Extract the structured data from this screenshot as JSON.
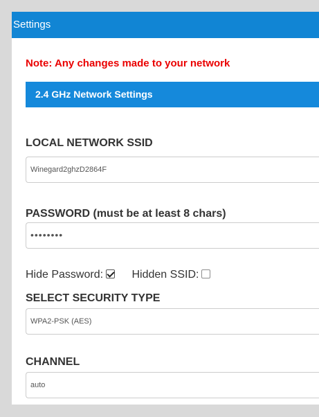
{
  "panel": {
    "title": "Settings"
  },
  "note": "Note: Any changes made to your network",
  "section": {
    "title": "2.4 GHz Network Settings"
  },
  "fields": {
    "ssid": {
      "label": "LOCAL NETWORK SSID",
      "value": "Winegard2ghzD2864F"
    },
    "password": {
      "label": "PASSWORD (must be at least 8 chars)",
      "value": "••••••••"
    },
    "security": {
      "label": "SELECT SECURITY TYPE",
      "value": "WPA2-PSK (AES)"
    },
    "channel": {
      "label": "CHANNEL",
      "value": "auto"
    }
  },
  "options": {
    "hide_password": {
      "label": "Hide Password:",
      "checked": true
    },
    "hidden_ssid": {
      "label": "Hidden SSID:",
      "checked": false
    }
  },
  "colors": {
    "header_blue": "#1185d4",
    "section_blue": "#1589db",
    "note_red": "#ea0000",
    "background": "#d9d9d9"
  }
}
